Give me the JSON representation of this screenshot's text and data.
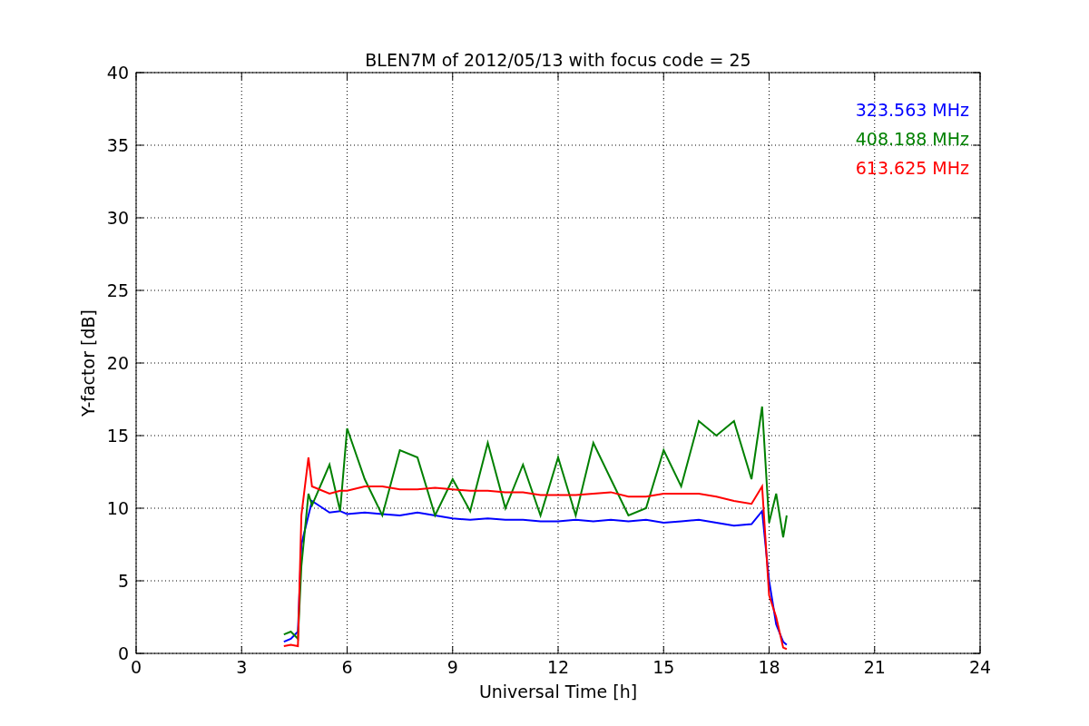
{
  "figure": {
    "chart_data": {
      "type": "line",
      "title": "BLEN7M of 2012/05/13 with focus code = 25",
      "xlabel": "Universal Time [h]",
      "ylabel": "Y-factor [dB]",
      "x": [
        4.2,
        4.4,
        4.6,
        4.7,
        4.9,
        5.0,
        5.5,
        5.8,
        6.0,
        6.5,
        7.0,
        7.5,
        8.0,
        8.5,
        9.0,
        9.5,
        10.0,
        10.5,
        11.0,
        11.5,
        12.0,
        12.5,
        13.0,
        13.5,
        14.0,
        14.5,
        15.0,
        15.5,
        16.0,
        16.5,
        17.0,
        17.5,
        17.8,
        18.0,
        18.2,
        18.4,
        18.5
      ],
      "series": [
        {
          "name": "323.563 MHz",
          "color": "#0000ff",
          "values": [
            0.8,
            1.0,
            1.5,
            7.5,
            9.5,
            10.5,
            9.7,
            9.8,
            9.6,
            9.7,
            9.6,
            9.5,
            9.7,
            9.5,
            9.3,
            9.2,
            9.3,
            9.2,
            9.2,
            9.1,
            9.1,
            9.2,
            9.1,
            9.2,
            9.1,
            9.2,
            9.0,
            9.1,
            9.2,
            9.0,
            8.8,
            8.9,
            9.8,
            5.0,
            2.0,
            0.8,
            0.6
          ]
        },
        {
          "name": "408.188 MHz",
          "color": "#008000",
          "values": [
            1.3,
            1.5,
            1.0,
            6.0,
            11.0,
            10.2,
            13.0,
            9.8,
            15.5,
            12.0,
            9.5,
            14.0,
            13.5,
            9.5,
            12.0,
            9.8,
            14.5,
            10.0,
            13.0,
            9.5,
            13.5,
            9.5,
            14.5,
            12.0,
            9.5,
            10.0,
            14.0,
            11.5,
            16.0,
            15.0,
            16.0,
            12.0,
            17.0,
            9.0,
            11.0,
            8.0,
            9.5
          ]
        },
        {
          "name": "613.625 MHz",
          "color": "#ff0000",
          "values": [
            0.5,
            0.6,
            0.5,
            9.5,
            13.5,
            11.5,
            11.0,
            11.2,
            11.2,
            11.5,
            11.5,
            11.3,
            11.3,
            11.4,
            11.3,
            11.2,
            11.2,
            11.1,
            11.1,
            10.9,
            10.9,
            10.9,
            11.0,
            11.1,
            10.8,
            10.8,
            11.0,
            11.0,
            11.0,
            10.8,
            10.5,
            10.3,
            11.5,
            4.0,
            2.5,
            0.4,
            0.3
          ]
        }
      ],
      "grid": true,
      "xlim": [
        0,
        24
      ],
      "ylim": [
        0,
        40
      ],
      "xticks": [
        0,
        3,
        6,
        9,
        12,
        15,
        18,
        21,
        24
      ],
      "yticks": [
        0,
        5,
        10,
        15,
        20,
        25,
        30,
        35,
        40
      ]
    }
  }
}
